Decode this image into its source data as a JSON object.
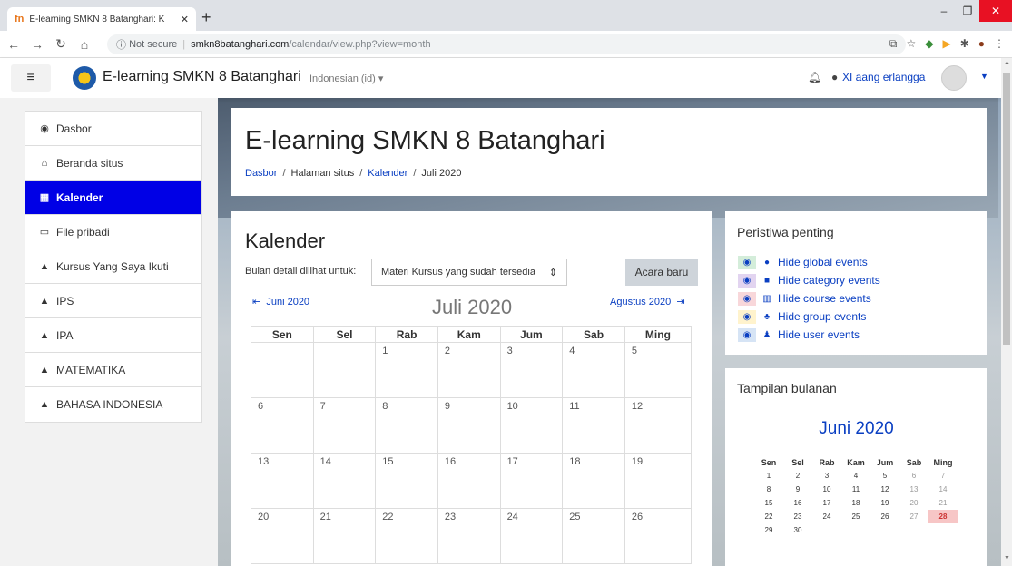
{
  "browser": {
    "tab_title": "E-learning SMKN 8 Batanghari: K",
    "tab_favicon": "fn",
    "security": "Not secure",
    "url_host": "smkn8batanghari.com",
    "url_path": "/calendar/view.php?view=month"
  },
  "site": {
    "brand": "E-learning SMKN 8 Batanghari",
    "language": "Indonesian (id)",
    "user": "XI aang erlangga"
  },
  "sidebar": {
    "items": [
      {
        "label": "Dasbor",
        "icon": "dashboard-icon"
      },
      {
        "label": "Beranda situs",
        "icon": "home-icon"
      },
      {
        "label": "Kalender",
        "icon": "calendar-icon",
        "active": true
      },
      {
        "label": "File pribadi",
        "icon": "file-icon"
      },
      {
        "label": "Kursus Yang Saya Ikuti",
        "icon": "graduation-cap-icon"
      },
      {
        "label": "IPS",
        "icon": "graduation-cap-icon"
      },
      {
        "label": "IPA",
        "icon": "graduation-cap-icon"
      },
      {
        "label": "MATEMATIKA",
        "icon": "graduation-cap-icon"
      },
      {
        "label": "BAHASA INDONESIA",
        "icon": "graduation-cap-icon"
      }
    ]
  },
  "header": {
    "title": "E-learning SMKN 8 Batanghari",
    "breadcrumb": [
      "Dasbor",
      "Halaman situs",
      "Kalender",
      "Juli 2020"
    ]
  },
  "calendar": {
    "heading": "Kalender",
    "detail_label": "Bulan detail dilihat untuk:",
    "course_select": "Materi Kursus yang sudah tersedia",
    "new_event_button": "Acara baru",
    "prev_month": "Juni 2020",
    "current_month": "Juli 2020",
    "next_month": "Agustus 2020",
    "weekdays": [
      "Sen",
      "Sel",
      "Rab",
      "Kam",
      "Jum",
      "Sab",
      "Ming"
    ],
    "weeks": [
      [
        "",
        "",
        "1",
        "2",
        "3",
        "4",
        "5"
      ],
      [
        "6",
        "7",
        "8",
        "9",
        "10",
        "11",
        "12"
      ],
      [
        "13",
        "14",
        "15",
        "16",
        "17",
        "18",
        "19"
      ],
      [
        "20",
        "21",
        "22",
        "23",
        "24",
        "25",
        "26"
      ]
    ]
  },
  "events_block": {
    "title": "Peristiwa penting",
    "items": [
      {
        "label": "Hide global events",
        "color": "#d4edda",
        "icon": "globe-icon"
      },
      {
        "label": "Hide category events",
        "color": "#e2d4f0",
        "icon": "cubes-icon"
      },
      {
        "label": "Hide course events",
        "color": "#f8d7da",
        "icon": "university-icon"
      },
      {
        "label": "Hide group events",
        "color": "#fff3cd",
        "icon": "users-icon"
      },
      {
        "label": "Hide user events",
        "color": "#d6e4f5",
        "icon": "user-icon"
      }
    ]
  },
  "mini_calendar": {
    "title": "Tampilan bulanan",
    "month": "Juni 2020",
    "weekdays": [
      "Sen",
      "Sel",
      "Rab",
      "Kam",
      "Jum",
      "Sab",
      "Ming"
    ],
    "weeks": [
      [
        "1",
        "2",
        "3",
        "4",
        "5",
        "6",
        "7"
      ],
      [
        "8",
        "9",
        "10",
        "11",
        "12",
        "13",
        "14"
      ],
      [
        "15",
        "16",
        "17",
        "18",
        "19",
        "20",
        "21"
      ],
      [
        "22",
        "23",
        "24",
        "25",
        "26",
        "27",
        "28"
      ],
      [
        "29",
        "30",
        "",
        "",
        "",
        "",
        ""
      ]
    ],
    "today": "28"
  }
}
